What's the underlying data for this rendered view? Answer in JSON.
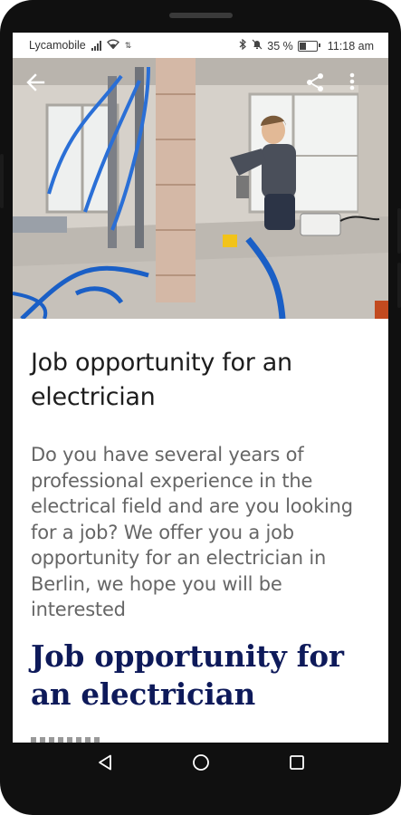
{
  "status_bar": {
    "carrier": "Lycamobile",
    "battery_percent": "35 %",
    "battery_level": 0.35,
    "time": "11:18 am",
    "icons": [
      "signal-icon",
      "wifi-icon",
      "bluetooth-icon",
      "mute-icon",
      "battery-icon"
    ]
  },
  "app_bar": {
    "icons": [
      "back-arrow-icon",
      "share-icon",
      "more-vert-icon"
    ]
  },
  "article": {
    "title": "Job opportunity for an electrician",
    "description": "Do you have several years of professional experience in the electrical field and are you looking for a job? We offer you a job opportunity for an electrician in Berlin, we hope you will be interested",
    "heading": "Job opportunity for an electrician"
  },
  "nav_bar": {
    "icons": [
      "back-triangle-icon",
      "home-circle-icon",
      "recents-square-icon"
    ]
  },
  "colors": {
    "heading": "#0e1a5a",
    "title": "#1d1d1d",
    "description": "#666666",
    "phone_frame": "#101010"
  }
}
